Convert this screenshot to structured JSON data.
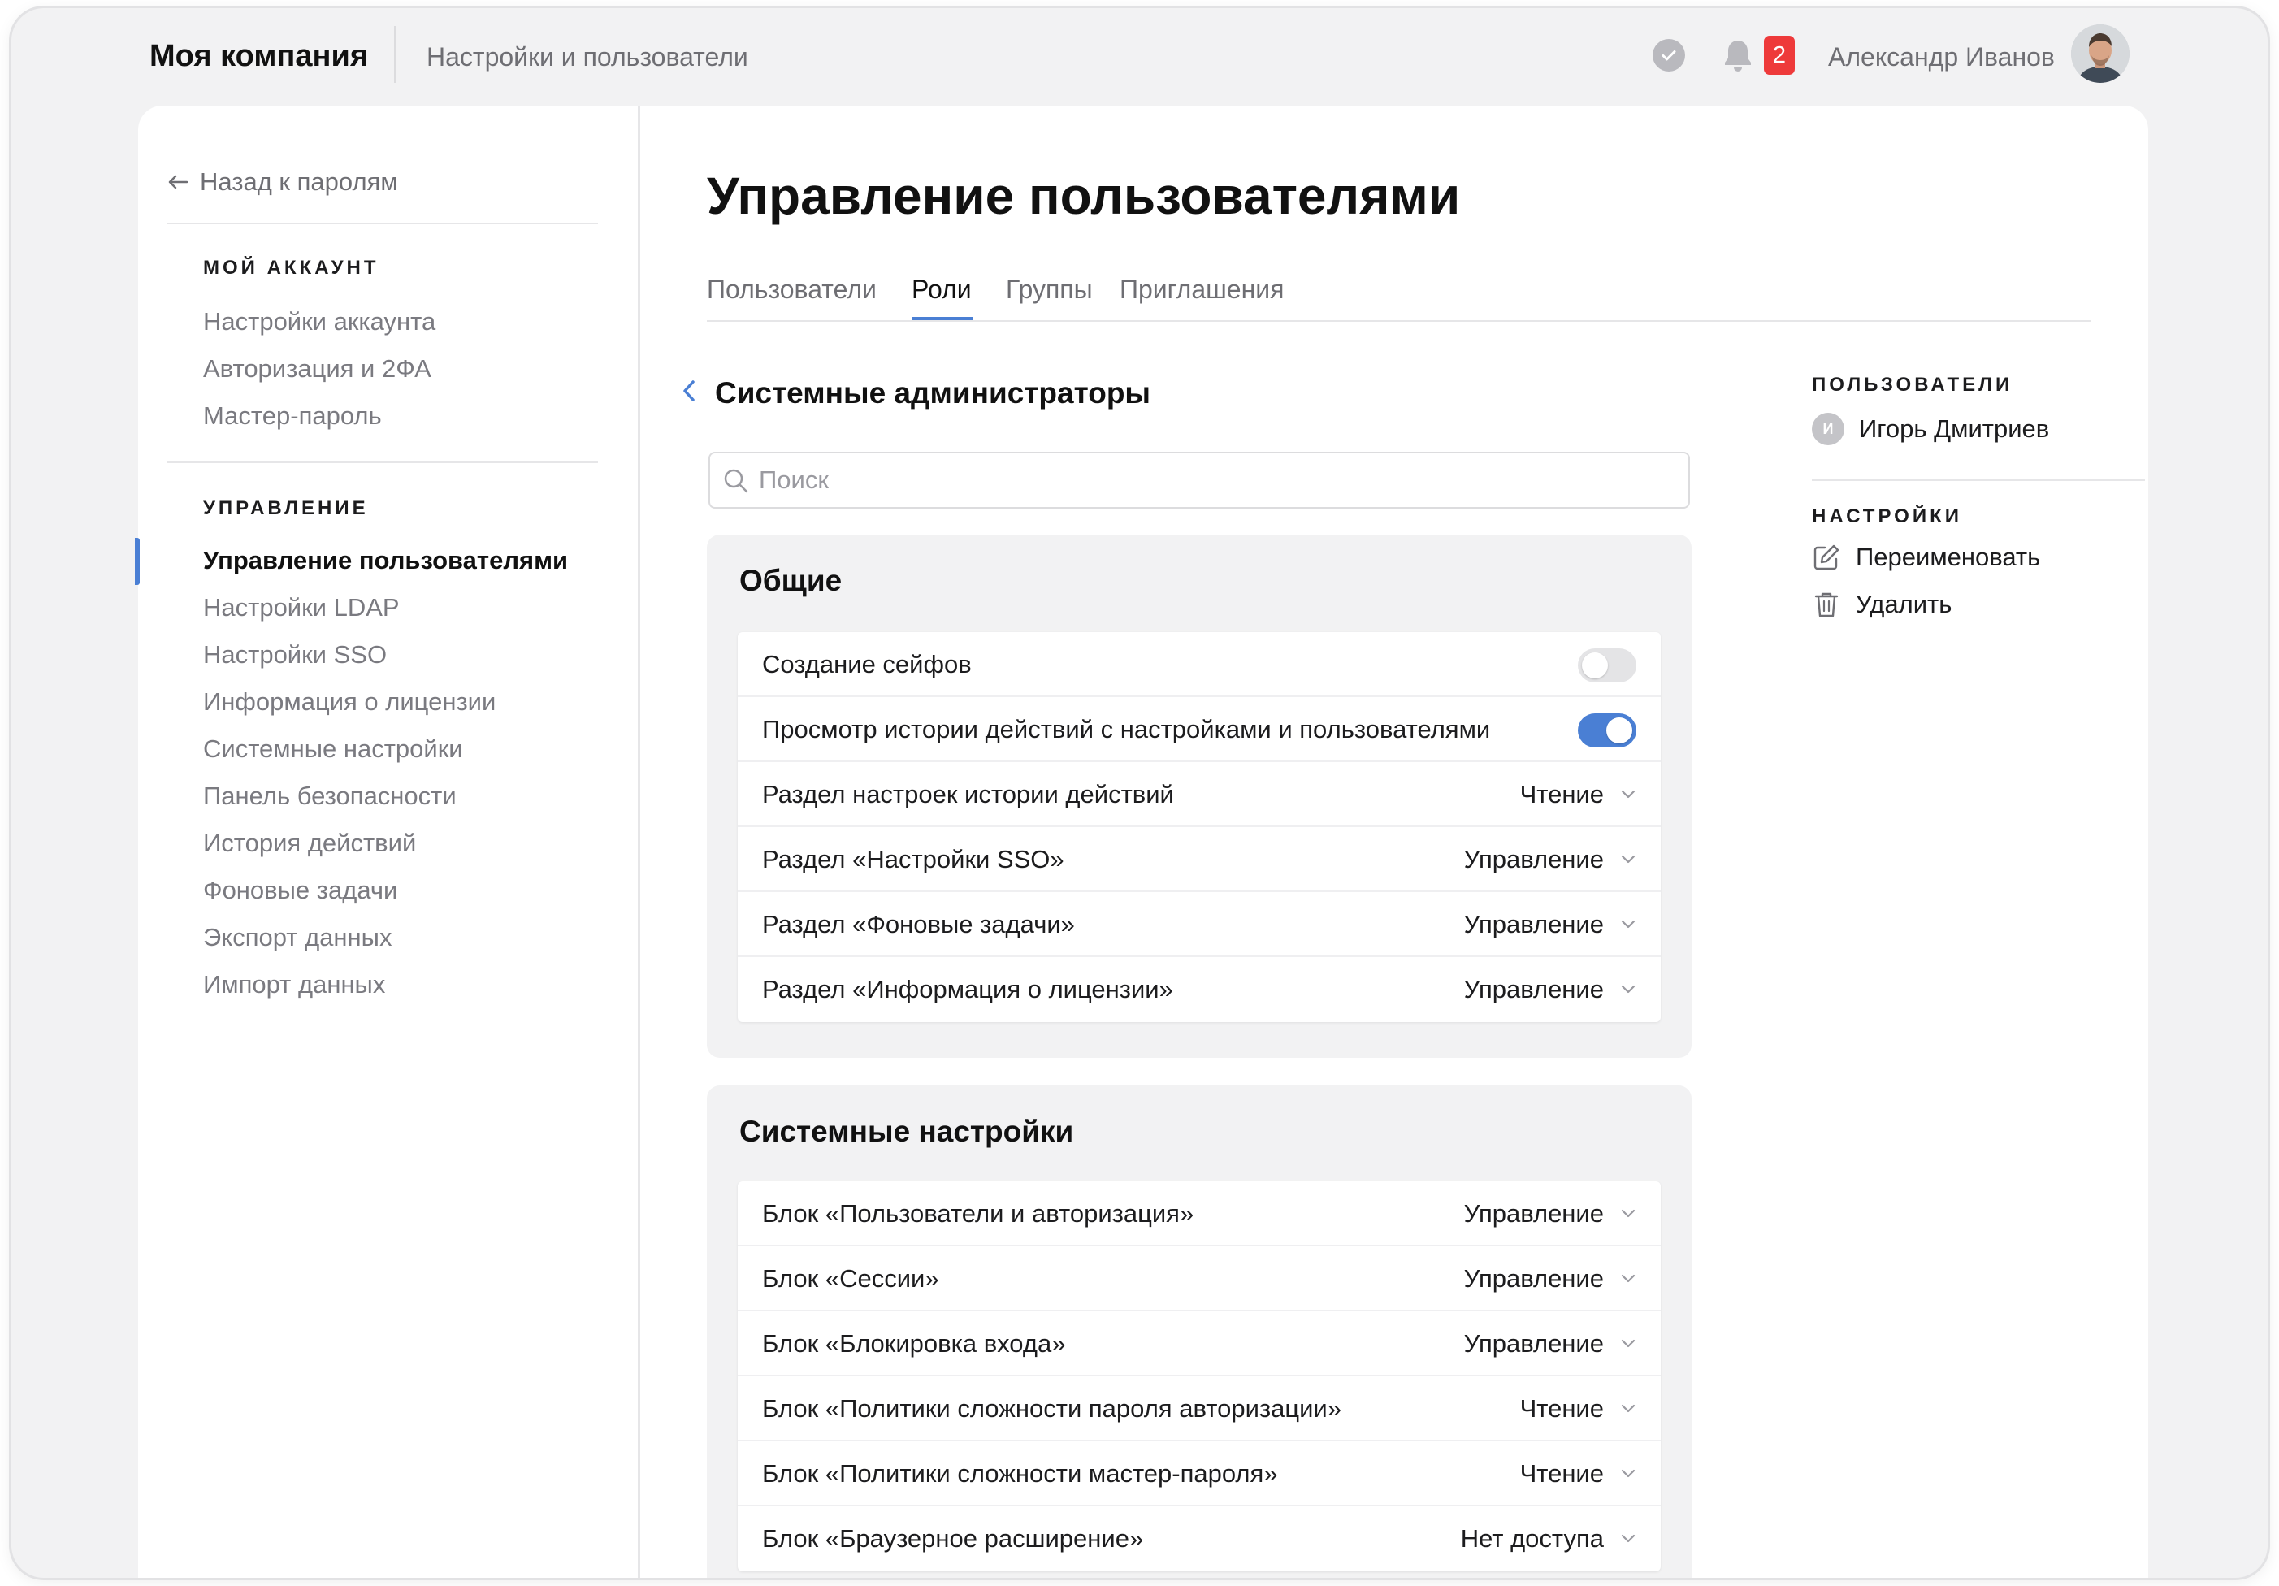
{
  "header": {
    "company": "Моя компания",
    "section": "Настройки и пользователи",
    "notification_count": "2",
    "user_name": "Александр Иванов"
  },
  "sidebar": {
    "back_label": "Назад к паролям",
    "account_heading": "МОЙ АККАУНТ",
    "account_items": [
      "Настройки аккаунта",
      "Авторизация и 2ФА",
      "Мастер-пароль"
    ],
    "management_heading": "УПРАВЛЕНИЕ",
    "management_items": [
      "Управление пользователями",
      "Настройки LDAP",
      "Настройки SSO",
      "Информация о лицензии",
      "Системные настройки",
      "Панель безопасности",
      "История действий",
      "Фоновые задачи",
      "Экспорт данных",
      "Импорт данных"
    ],
    "active_item": "Управление пользователями"
  },
  "main": {
    "title": "Управление пользователями",
    "tabs": [
      "Пользователи",
      "Роли",
      "Группы",
      "Приглашения"
    ],
    "active_tab": "Роли",
    "role_title": "Системные администраторы",
    "search_placeholder": "Поиск",
    "groups": [
      {
        "title": "Общие",
        "rows": [
          {
            "label": "Создание сейфов",
            "type": "toggle",
            "on": false
          },
          {
            "label": "Просмотр истории действий с настройками и пользователями",
            "type": "toggle",
            "on": true
          },
          {
            "label": "Раздел настроек истории действий",
            "type": "select",
            "value": "Чтение"
          },
          {
            "label": "Раздел «Настройки SSO»",
            "type": "select",
            "value": "Управление"
          },
          {
            "label": "Раздел «Фоновые задачи»",
            "type": "select",
            "value": "Управление"
          },
          {
            "label": "Раздел «Информация о лицензии»",
            "type": "select",
            "value": "Управление"
          }
        ]
      },
      {
        "title": "Системные настройки",
        "rows": [
          {
            "label": "Блок «Пользователи и авторизация»",
            "type": "select",
            "value": "Управление"
          },
          {
            "label": "Блок «Сессии»",
            "type": "select",
            "value": "Управление"
          },
          {
            "label": "Блок «Блокировка входа»",
            "type": "select",
            "value": "Управление"
          },
          {
            "label": "Блок «Политики сложности пароля авторизации»",
            "type": "select",
            "value": "Чтение"
          },
          {
            "label": "Блок «Политики сложности мастер-пароля»",
            "type": "select",
            "value": "Чтение"
          },
          {
            "label": "Блок «Браузерное расширение»",
            "type": "select",
            "value": "Нет доступа"
          }
        ]
      }
    ]
  },
  "right_panel": {
    "users_heading": "ПОЛЬЗОВАТЕЛИ",
    "user_initial": "И",
    "user_name": "Игорь Дмитриев",
    "settings_heading": "НАСТРОЙКИ",
    "rename_label": "Переименовать",
    "delete_label": "Удалить"
  },
  "colors": {
    "accent": "#4a7fd4",
    "badge": "#ee3a3a",
    "muted_text": "#7a7a80",
    "panel_bg": "#f2f2f3"
  },
  "icons": {
    "status": "check-circle-icon",
    "notifications": "bell-icon",
    "back": "arrow-left-icon",
    "role_back": "chevron-left-icon",
    "search": "search-icon",
    "select": "chevron-down-icon",
    "rename": "edit-icon",
    "delete": "trash-icon"
  }
}
